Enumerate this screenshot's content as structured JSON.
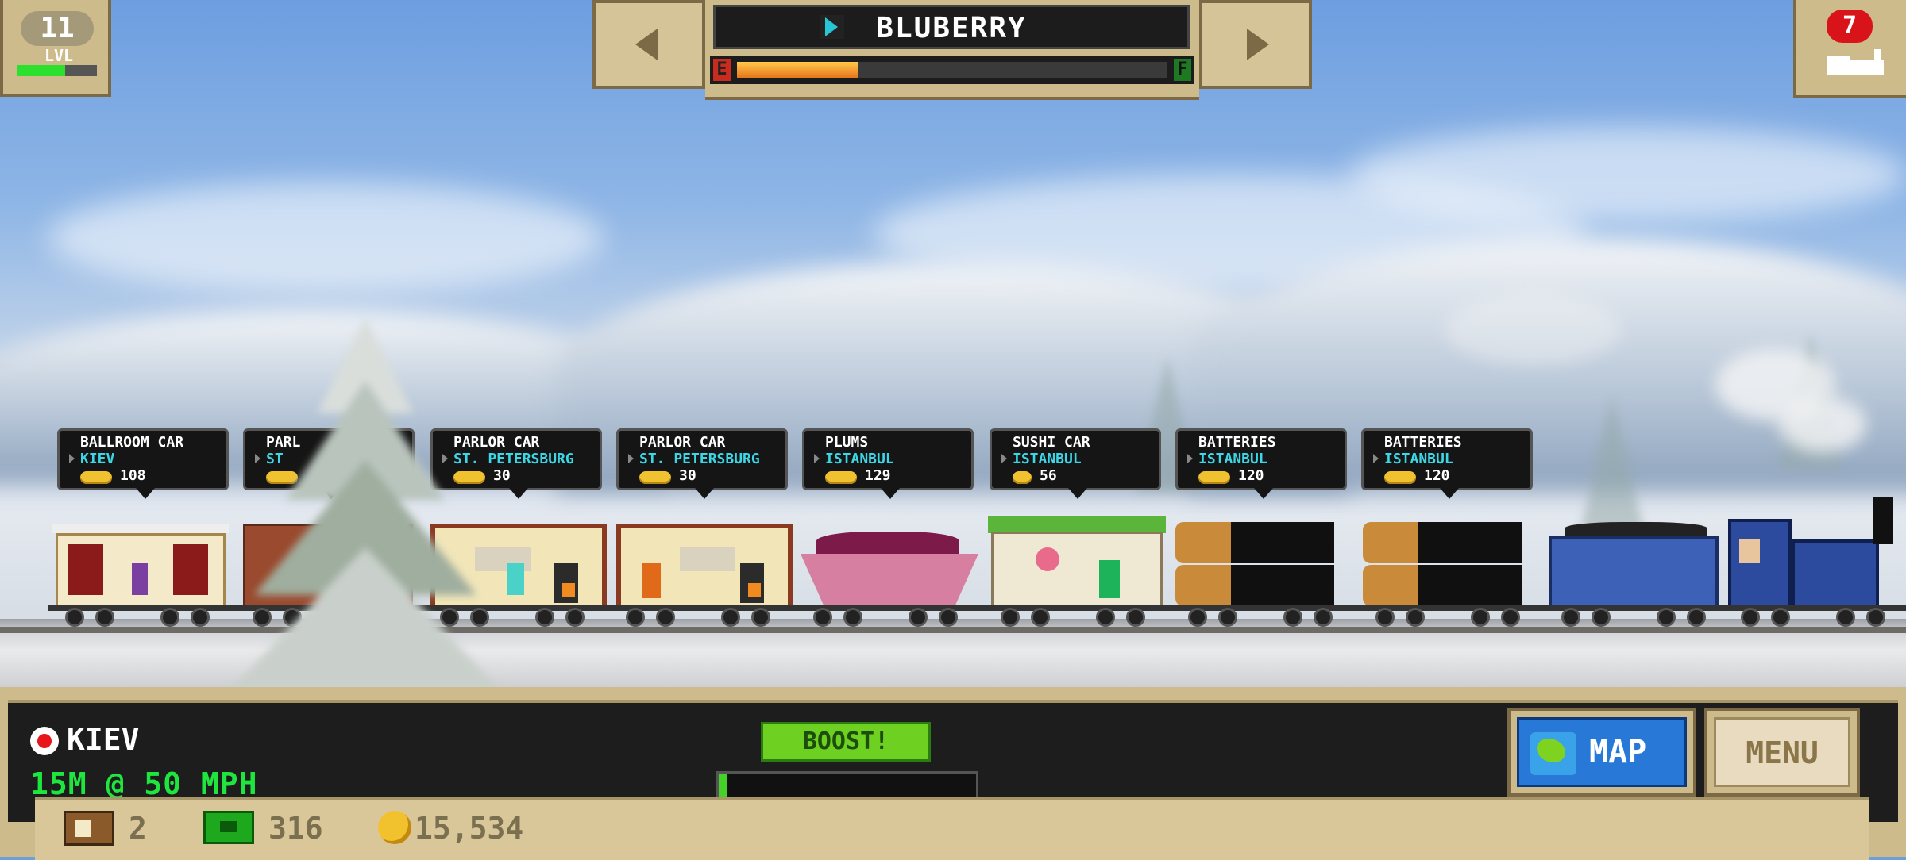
{
  "hud": {
    "level": {
      "number": "11",
      "label": "LVL",
      "progress": 0.6
    },
    "train_selector": {
      "name": "BLUBERRY",
      "fuel_empty_label": "E",
      "fuel_full_label": "F",
      "fuel_level": 0.28
    },
    "trains_badge": "7"
  },
  "cars": [
    {
      "name": "BALLROOM CAR",
      "destination": "KIEV",
      "value": "108"
    },
    {
      "name": "PARL",
      "destination": "ST",
      "value": ""
    },
    {
      "name": "PARLOR CAR",
      "destination": "ST. PETERSBURG",
      "value": "30"
    },
    {
      "name": "PARLOR CAR",
      "destination": "ST. PETERSBURG",
      "value": "30"
    },
    {
      "name": "PLUMS",
      "destination": "ISTANBUL",
      "value": "129"
    },
    {
      "name": "SUSHI CAR",
      "destination": "ISTANBUL",
      "value": "56"
    },
    {
      "name": "BATTERIES",
      "destination": "ISTANBUL",
      "value": "120"
    },
    {
      "name": "BATTERIES",
      "destination": "ISTANBUL",
      "value": "120"
    }
  ],
  "status": {
    "station": "KIEV",
    "speed_text": "15M @ 50 MPH",
    "boost_label": "BOOST!",
    "boost_level": 0.03
  },
  "buttons": {
    "map_label": "MAP",
    "menu_label": "MENU"
  },
  "resources": {
    "crates": "2",
    "cash": "316",
    "coins": "15,534"
  },
  "colors": {
    "panel_tan": "#cdbb8c",
    "accent_green": "#1fe53f",
    "destination_cyan": "#3cd7e6",
    "map_blue": "#2878d8",
    "badge_red": "#d8141a"
  },
  "icons": [
    "level-badge-icon",
    "train-icon",
    "left-arrow-icon",
    "right-arrow-icon",
    "locomotive-icon",
    "station-marker-icon",
    "coin-icon",
    "crate-icon",
    "cash-icon",
    "map-icon"
  ]
}
